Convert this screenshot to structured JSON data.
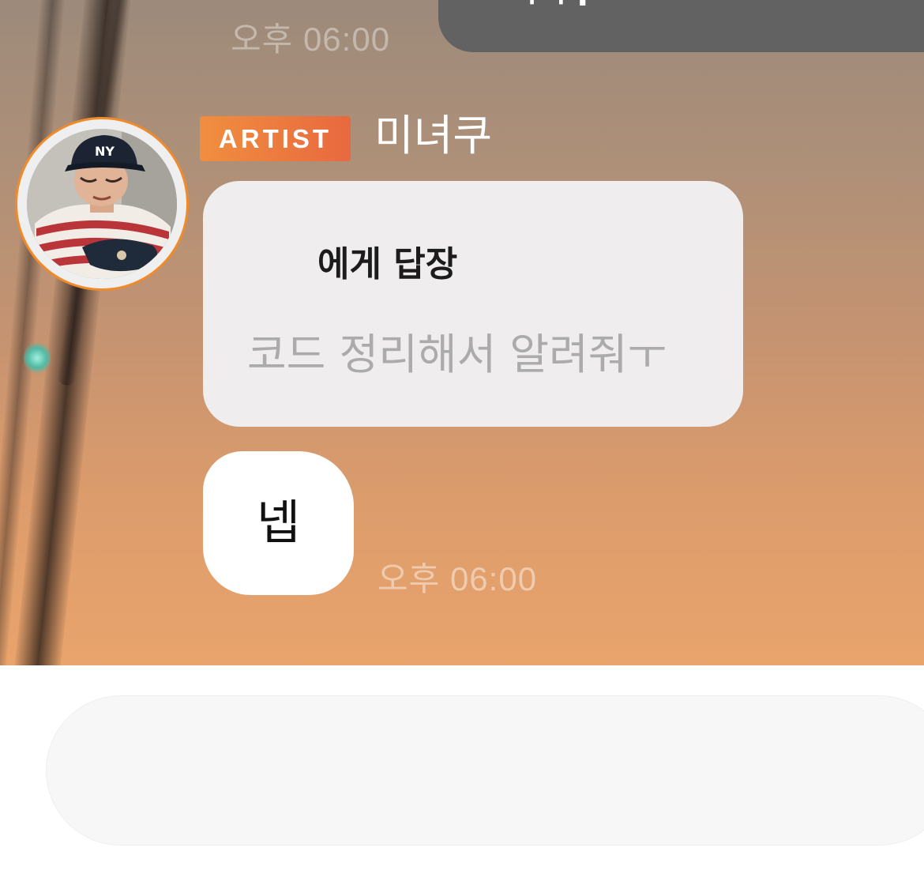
{
  "chat": {
    "previous_time": "오후 06:00",
    "outgoing_fragment": "ㅜㅜ!",
    "sender": {
      "badge": "ARTIST",
      "name": "미녀쿠",
      "avatar_icon": "profile-photo"
    },
    "reply": {
      "target_label": "에게 답장",
      "quoted_text": "코드 정리해서 알려줘ㅜ"
    },
    "message": {
      "text": "넵",
      "time": "오후 06:00"
    }
  },
  "composer": {
    "placeholder": ""
  },
  "colors": {
    "badge_start": "#f08e3f",
    "badge_end": "#e8693f",
    "avatar_ring": "#f08b2c",
    "outgoing_bubble": "#626262",
    "reply_bubble": "#efeded",
    "message_bubble": "#ffffff"
  }
}
